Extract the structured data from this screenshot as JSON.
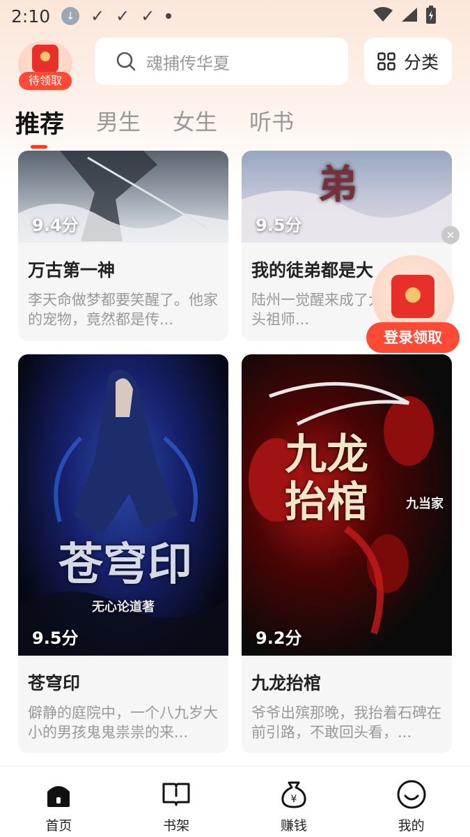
{
  "status_bar": {
    "time": "2:10"
  },
  "header": {
    "redpack_label": "待领取",
    "search_placeholder": "魂捕传华夏",
    "category_label": "分类"
  },
  "tabs": [
    {
      "label": "推荐",
      "active": true
    },
    {
      "label": "男生",
      "active": false
    },
    {
      "label": "女生",
      "active": false
    },
    {
      "label": "听书",
      "active": false
    }
  ],
  "books": [
    {
      "title": "万古第一神",
      "score": "9.4分",
      "desc": "李天命做梦都要笑醒了。他家的宠物，竟然都是传..."
    },
    {
      "title": "我的徒弟都是大",
      "score": "9.5分",
      "desc": "陆州一觉醒来成了大最老的魔头祖师..."
    },
    {
      "title": "苍穹印",
      "score": "9.5分",
      "desc": "僻静的庭院中，一个八九岁大小的男孩鬼鬼祟祟的来...",
      "cover_text": "苍穹印",
      "cover_author": "无心论道著"
    },
    {
      "title": "九龙抬棺",
      "score": "9.2分",
      "desc": "爷爷出殡那晚，我抬着石碑在前引路，不敢回头看，...",
      "cover_text": "九龙抬棺",
      "cover_author": "九当家"
    }
  ],
  "cover_art": {
    "book2_glyph": "弟"
  },
  "promo": {
    "label": "登录领取",
    "close": "×"
  },
  "bottom_nav": [
    {
      "label": "首页",
      "icon": "home-icon",
      "active": true
    },
    {
      "label": "书架",
      "icon": "bookshelf-icon",
      "active": false
    },
    {
      "label": "赚钱",
      "icon": "money-bag-icon",
      "active": false
    },
    {
      "label": "我的",
      "icon": "profile-icon",
      "active": false
    }
  ],
  "colors": {
    "accent": "#ff3b1f",
    "badge": "#ff4a35"
  }
}
